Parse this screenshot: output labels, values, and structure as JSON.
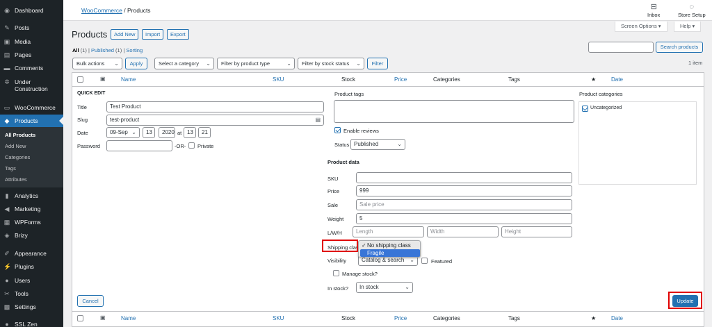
{
  "sidebar": {
    "items": [
      {
        "label": "Dashboard",
        "icon": "dashboard-icon",
        "glyph": "◉"
      },
      {
        "label": "Posts",
        "icon": "pin-icon",
        "glyph": "✎"
      },
      {
        "label": "Media",
        "icon": "media-icon",
        "glyph": "▣"
      },
      {
        "label": "Pages",
        "icon": "pages-icon",
        "glyph": "▤"
      },
      {
        "label": "Comments",
        "icon": "comments-icon",
        "glyph": "▬"
      },
      {
        "label": "Under Construction",
        "icon": "gear-icon",
        "glyph": "✲"
      },
      {
        "label": "WooCommerce",
        "icon": "woocommerce-icon",
        "glyph": "▭"
      },
      {
        "label": "Products",
        "icon": "products-icon",
        "glyph": "◆"
      },
      {
        "label": "Analytics",
        "icon": "analytics-icon",
        "glyph": "▮"
      },
      {
        "label": "Marketing",
        "icon": "megaphone-icon",
        "glyph": "◀"
      },
      {
        "label": "WPForms",
        "icon": "forms-icon",
        "glyph": "▦"
      },
      {
        "label": "Brizy",
        "icon": "brizy-icon",
        "glyph": "◈"
      },
      {
        "label": "Appearance",
        "icon": "brush-icon",
        "glyph": "✐"
      },
      {
        "label": "Plugins",
        "icon": "plugin-icon",
        "glyph": "⚡"
      },
      {
        "label": "Users",
        "icon": "users-icon",
        "glyph": "●"
      },
      {
        "label": "Tools",
        "icon": "wrench-icon",
        "glyph": "✂"
      },
      {
        "label": "Settings",
        "icon": "settings-icon",
        "glyph": "▩"
      },
      {
        "label": "SSL Zen",
        "icon": "ssl-icon",
        "glyph": "●"
      }
    ],
    "submenu": [
      "All Products",
      "Add New",
      "Categories",
      "Tags",
      "Attributes"
    ]
  },
  "topbar": {
    "breadcrumb_link": "WooCommerce",
    "breadcrumb_sep": "/",
    "breadcrumb_current": "Products",
    "inbox": "Inbox",
    "store_setup": "Store Setup"
  },
  "screen_options": "Screen Options ▾",
  "help": "Help ▾",
  "page": {
    "title": "Products",
    "add_new": "Add New",
    "import": "Import",
    "export": "Export",
    "views": {
      "all": "All",
      "all_count": "(1)",
      "sep1": "|",
      "published": "Published",
      "published_count": "(1)",
      "sep2": "|",
      "sorting": "Sorting"
    },
    "search_button": "Search products",
    "item_count": "1 item"
  },
  "filters": {
    "bulk_actions": "Bulk actions",
    "apply": "Apply",
    "category": "Select a category",
    "product_type": "Filter by product type",
    "stock_status": "Filter by stock status",
    "filter": "Filter"
  },
  "columns": {
    "name": "Name",
    "sku": "SKU",
    "stock": "Stock",
    "price": "Price",
    "categories": "Categories",
    "tags": "Tags",
    "star": "★",
    "date": "Date"
  },
  "quick_edit": {
    "heading": "QUICK EDIT",
    "title_label": "Title",
    "title_value": "Test Product",
    "slug_label": "Slug",
    "slug_value": "test-product",
    "date_label": "Date",
    "month": "09-Sep",
    "day": "13",
    "year": "2020",
    "at": "at",
    "hour": "13",
    "minute": "21",
    "password_label": "Password",
    "or": "-OR-",
    "private": "Private",
    "tags_label": "Product tags",
    "enable_reviews": "Enable reviews",
    "status_label": "Status",
    "status_value": "Published",
    "product_data": "Product data",
    "sku_label": "SKU",
    "price_label": "Price",
    "price_value": "999",
    "sale_label": "Sale",
    "sale_placeholder": "Sale price",
    "weight_label": "Weight",
    "weight_value": "5",
    "lwh_label": "L/W/H",
    "length_ph": "Length",
    "width_ph": "Width",
    "height_ph": "Height",
    "shipping_label": "Shipping class",
    "shipping_options": [
      "No shipping class",
      "Fragile"
    ],
    "visibility_label": "Visibility",
    "visibility_value": "Catalog & search",
    "featured": "Featured",
    "manage_stock": "Manage stock?",
    "in_stock_label": "In stock?",
    "in_stock_value": "In stock",
    "categories_label": "Product categories",
    "category_item": "Uncategorized",
    "cancel": "Cancel",
    "update": "Update"
  },
  "colors": {
    "accent": "#2271b1",
    "sidebar_bg": "#1d2327",
    "highlight": "#e00000",
    "dropdown_hover": "#3875d7"
  }
}
